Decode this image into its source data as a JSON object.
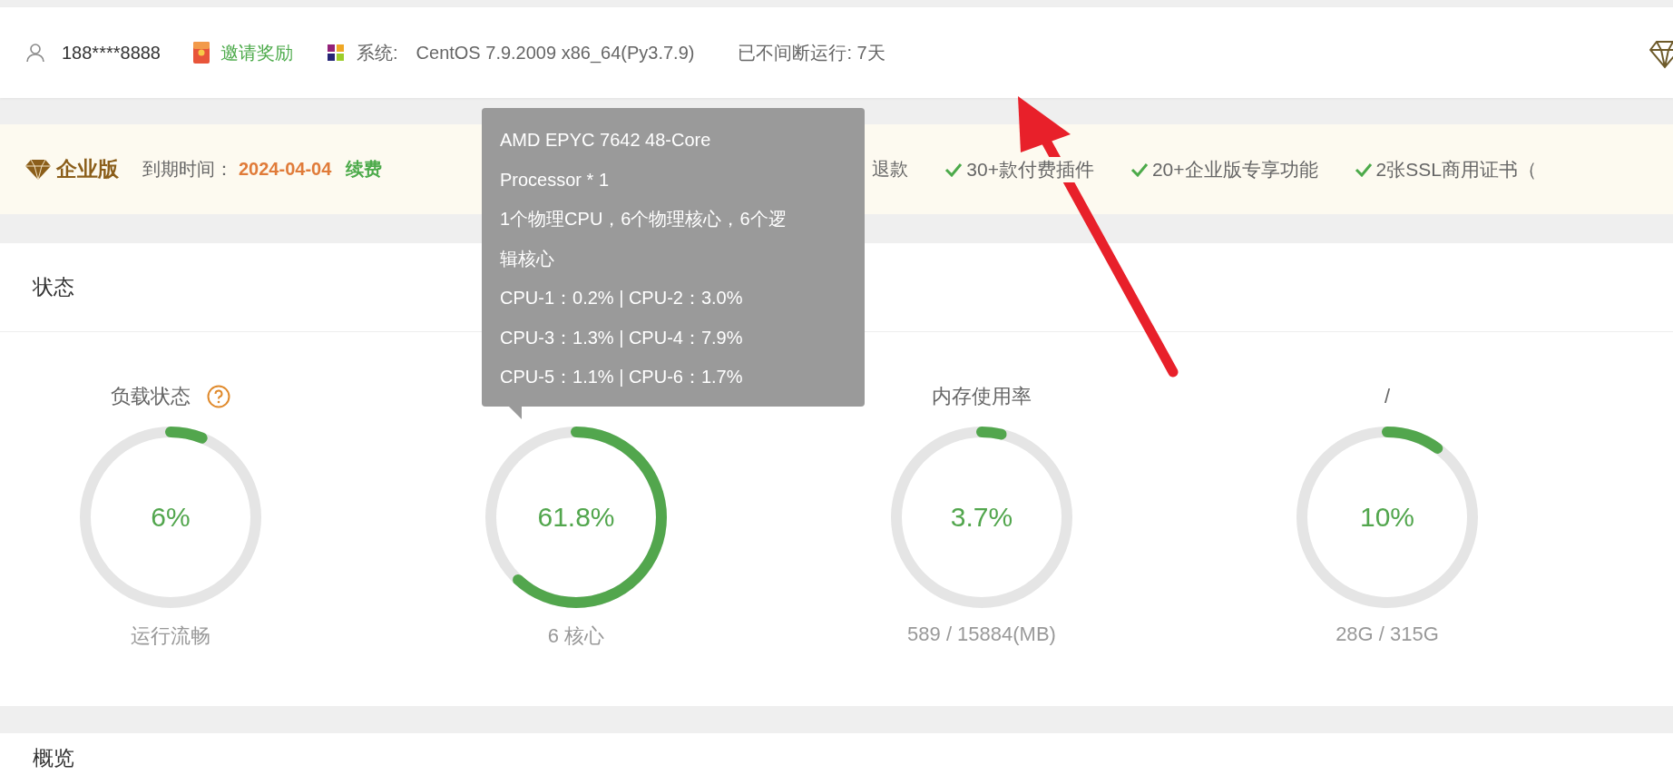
{
  "top_bar": {
    "user": "188****8888",
    "invite": "邀请奖励",
    "system_label": "系统:",
    "system_value": "CentOS 7.9.2009 x86_64(Py3.7.9)",
    "uptime": "已不间断运行: 7天"
  },
  "enterprise_bar": {
    "edition": "企业版",
    "expiry_label": "到期时间：",
    "expiry_date": "2024-04-04",
    "renew": "续费",
    "partial_text": "退款",
    "features": [
      "30+款付费插件",
      "20+企业版专享功能",
      "2张SSL商用证书（"
    ]
  },
  "status": {
    "title": "状态",
    "gauges": [
      {
        "title": "负载状态",
        "help": true,
        "value": "6%",
        "caption": "运行流畅"
      },
      {
        "help": false,
        "value": "61.8%",
        "caption": "6 核心"
      },
      {
        "title": "内存使用率",
        "help": false,
        "value": "3.7%",
        "caption": "589 / 15884(MB)"
      },
      {
        "title": "/",
        "help": false,
        "value": "10%",
        "caption": "28G / 315G"
      }
    ]
  },
  "tooltip": {
    "lines": [
      "AMD EPYC 7642 48-Core",
      "Processor * 1",
      "1个物理CPU，6个物理核心，6个逻",
      "辑核心",
      "CPU-1：0.2% | CPU-2：3.0%",
      "CPU-3：1.3% | CPU-4：7.9%",
      "CPU-5：1.1% | CPU-6：1.7%"
    ]
  },
  "overview": {
    "title": "概览"
  }
}
